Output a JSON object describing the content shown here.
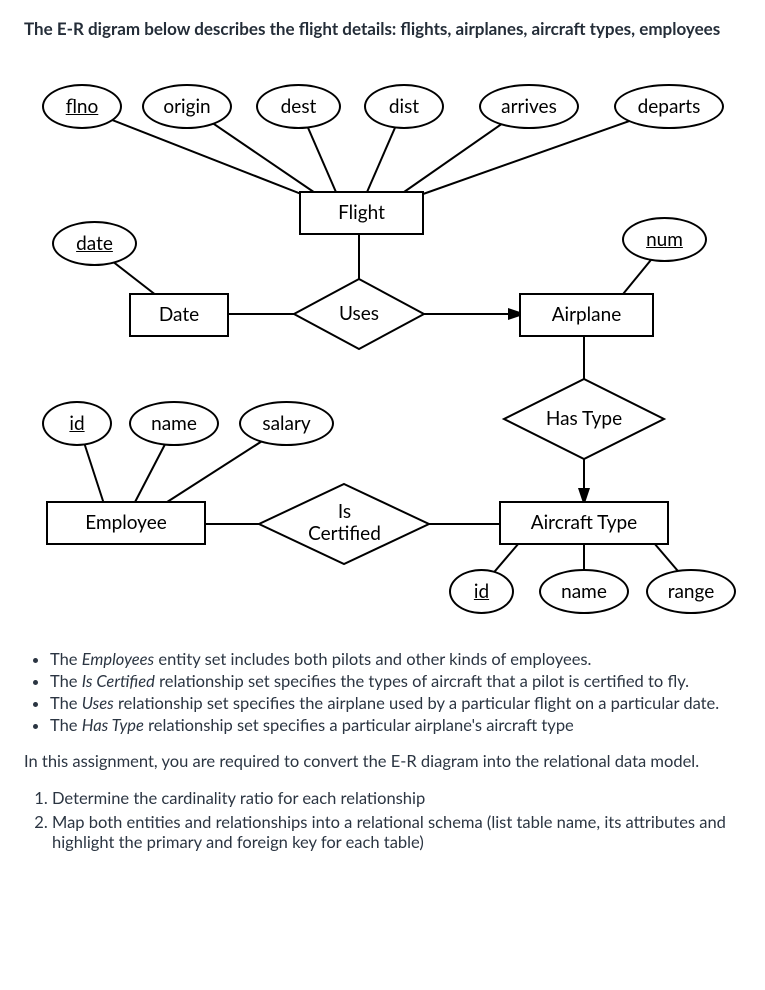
{
  "title": "The E-R digram below describes the flight details: flights, airplanes, aircraft types, employees",
  "entities": {
    "flight": "Flight",
    "date": "Date",
    "airplane": "Airplane",
    "employee": "Employee",
    "aircraft_type": "Aircraft Type"
  },
  "relationships": {
    "uses": "Uses",
    "has_type": "Has Type",
    "is_certified": "Is\nCertified"
  },
  "attributes": {
    "flno": "flno",
    "origin": "origin",
    "dest": "dest",
    "dist": "dist",
    "arrives": "arrives",
    "departs": "departs",
    "date_attr": "date",
    "num": "num",
    "emp_id": "id",
    "emp_name": "name",
    "emp_salary": "salary",
    "ac_id": "id",
    "ac_name": "name",
    "ac_range": "range"
  },
  "bullets": [
    {
      "pre": "The ",
      "em": "Employees",
      "post": " entity set includes both pilots and other kinds of employees."
    },
    {
      "pre": "The ",
      "em": "Is Certified",
      "post": " relationship set specifies the types of aircraft that a pilot is certified to fly."
    },
    {
      "pre": "The ",
      "em": "Uses",
      "post": " relationship set specifies the airplane used by a particular flight on a particular date."
    },
    {
      "pre": "The ",
      "em": "Has Type",
      "post": " relationship set specifies a particular airplane's aircraft type"
    }
  ],
  "intro": "In this assignment, you are required to convert the E-R diagram into the relational data model.",
  "tasks": [
    "Determine the cardinality ratio for each relationship",
    "Map both entities and relationships into a relational schema (list table name, its attributes and highlight the primary and foreign key for each table)"
  ]
}
